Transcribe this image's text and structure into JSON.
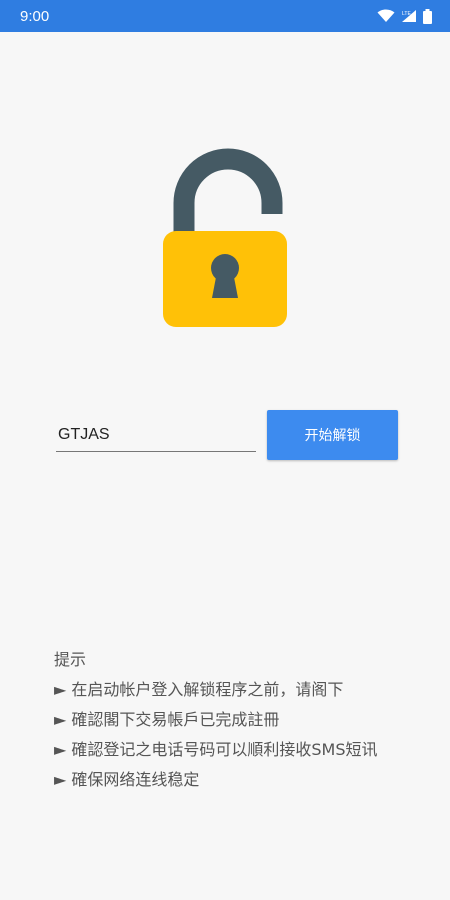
{
  "status_bar": {
    "time": "9:00",
    "background": "#2f7de1",
    "icons": [
      "wifi-icon",
      "lte-signal-icon",
      "battery-icon"
    ]
  },
  "lock_icon": {
    "shackle_color": "#455a64",
    "body_color": "#ffc107",
    "keyhole_color": "#455a64"
  },
  "form": {
    "code_value": "GTJAS",
    "unlock_button_label": "开始解锁",
    "button_color": "#3d8bef"
  },
  "hints": {
    "title": "提示",
    "items": [
      "► 在启动帐户登入解锁程序之前，请阁下",
      "► 確認閣下交易帳戶已完成註冊",
      "► 確認登记之电话号码可以順利接收SMS短讯",
      "► 確保网络连线稳定"
    ]
  }
}
